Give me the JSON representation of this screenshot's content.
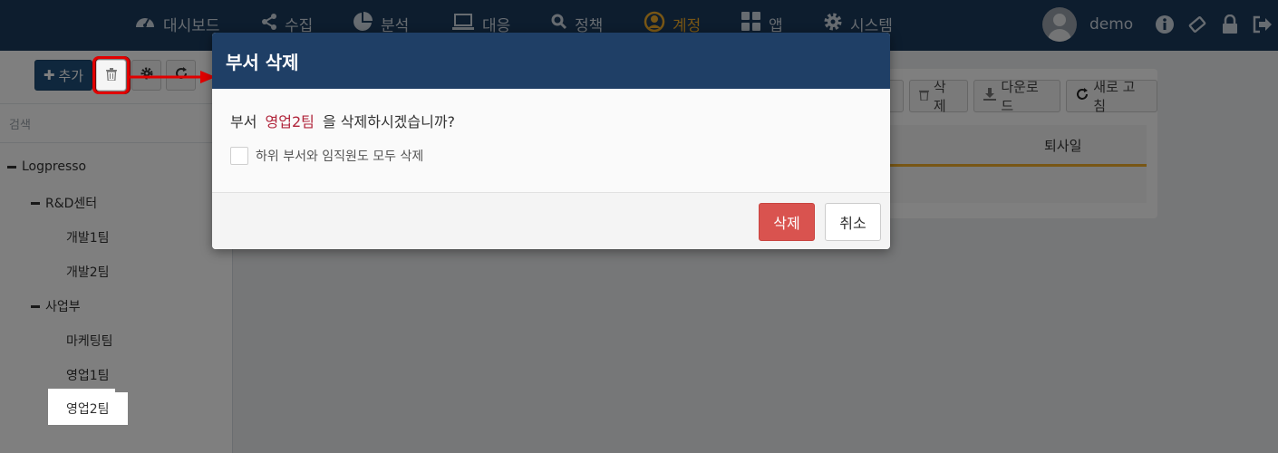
{
  "nav": {
    "items": [
      {
        "label": "대시보드",
        "icon": "dashboard-icon"
      },
      {
        "label": "수집",
        "icon": "share-icon"
      },
      {
        "label": "분석",
        "icon": "pie-chart-icon"
      },
      {
        "label": "대응",
        "icon": "laptop-icon"
      },
      {
        "label": "정책",
        "icon": "search-icon"
      },
      {
        "label": "계정",
        "icon": "user-circle-icon"
      },
      {
        "label": "앱",
        "icon": "apps-grid-icon"
      },
      {
        "label": "시스템",
        "icon": "gear-icon"
      }
    ],
    "active_color": "#f0ad2a",
    "username": "demo"
  },
  "sidebar": {
    "add_label": "추가",
    "search_placeholder": "검색",
    "tree": {
      "root": "Logpresso",
      "group1": "R&D센터",
      "g1_children": [
        "개발1팀",
        "개발2팀"
      ],
      "group2": "사업부",
      "g2_children": [
        "마케팅팀",
        "영업1팀",
        "영업2팀"
      ]
    }
  },
  "panel": {
    "delete_label": "삭제",
    "download_label": "다운로드",
    "refresh_label": "새로 고침",
    "column_header": "퇴사일"
  },
  "modal": {
    "title": "부서 삭제",
    "q_prefix": "부서",
    "q_target": "영업2팀",
    "q_suffix": "을 삭제하시겠습니까?",
    "checkbox_label": "하위 부서와 임직원도 모두 삭제",
    "delete_button": "삭제",
    "cancel_button": "취소"
  }
}
